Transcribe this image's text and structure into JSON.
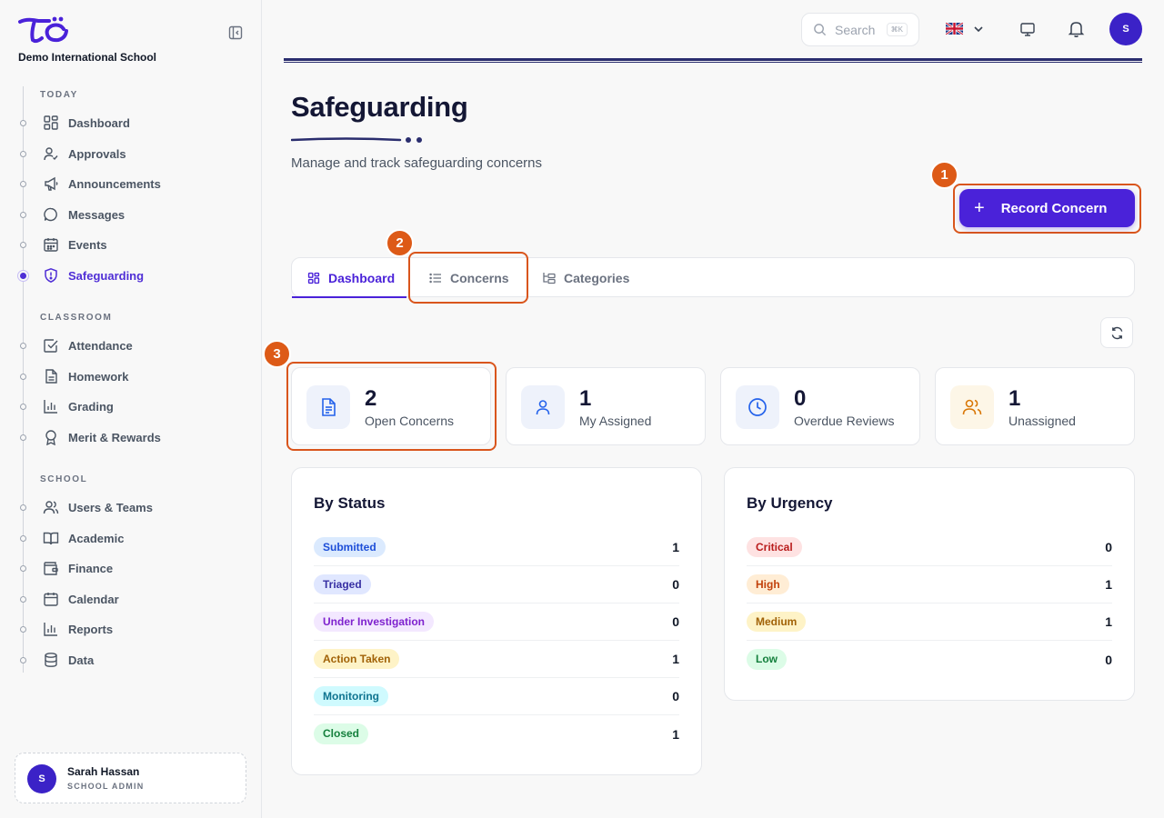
{
  "sidebar": {
    "school_name": "Demo International School",
    "sections": {
      "today": "TODAY",
      "classroom": "CLASSROOM",
      "school": "SCHOOL"
    },
    "items": {
      "dashboard": "Dashboard",
      "approvals": "Approvals",
      "announcements": "Announcements",
      "messages": "Messages",
      "events": "Events",
      "safeguarding": "Safeguarding",
      "attendance": "Attendance",
      "homework": "Homework",
      "grading": "Grading",
      "merit": "Merit & Rewards",
      "users": "Users & Teams",
      "academic": "Academic",
      "finance": "Finance",
      "calendar": "Calendar",
      "reports": "Reports",
      "data": "Data"
    },
    "active_item": "safeguarding",
    "user": {
      "initial": "S",
      "name": "Sarah Hassan",
      "role": "SCHOOL ADMIN"
    }
  },
  "topbar": {
    "search_placeholder": "Search",
    "search_shortcut": "⌘K",
    "language_icon": "uk-flag-icon",
    "avatar_initial": "S"
  },
  "page": {
    "title": "Safeguarding",
    "subtitle": "Manage and track safeguarding concerns",
    "record_button": "Record Concern"
  },
  "annotations": [
    "1",
    "2",
    "3"
  ],
  "tabs": {
    "dashboard": "Dashboard",
    "concerns": "Concerns",
    "categories": "Categories"
  },
  "stats": [
    {
      "value": "2",
      "label": "Open Concerns",
      "icon": "document-icon",
      "color": "#2563eb",
      "bg": "#eef2fb"
    },
    {
      "value": "1",
      "label": "My Assigned",
      "icon": "user-icon",
      "color": "#2563eb",
      "bg": "#eef2fb"
    },
    {
      "value": "0",
      "label": "Overdue Reviews",
      "icon": "clock-icon",
      "color": "#2563eb",
      "bg": "#eef2fb"
    },
    {
      "value": "1",
      "label": "Unassigned",
      "icon": "users-icon",
      "color": "#d97706",
      "bg": "#fdf6e7"
    }
  ],
  "by_status": {
    "title": "By Status",
    "rows": [
      {
        "label": "Submitted",
        "value": "1",
        "fg": "#1d4ed8",
        "bg": "#dbeafe"
      },
      {
        "label": "Triaged",
        "value": "0",
        "fg": "#3730a3",
        "bg": "#e0e7ff"
      },
      {
        "label": "Under Investigation",
        "value": "0",
        "fg": "#7e22ce",
        "bg": "#f3e8ff"
      },
      {
        "label": "Action Taken",
        "value": "1",
        "fg": "#a16207",
        "bg": "#fef3c7"
      },
      {
        "label": "Monitoring",
        "value": "0",
        "fg": "#0e7490",
        "bg": "#cffafe"
      },
      {
        "label": "Closed",
        "value": "1",
        "fg": "#15803d",
        "bg": "#dcfce7"
      }
    ]
  },
  "by_urgency": {
    "title": "By Urgency",
    "rows": [
      {
        "label": "Critical",
        "value": "0",
        "fg": "#b91c1c",
        "bg": "#fee2e2"
      },
      {
        "label": "High",
        "value": "1",
        "fg": "#c2410c",
        "bg": "#ffedd5"
      },
      {
        "label": "Medium",
        "value": "1",
        "fg": "#a16207",
        "bg": "#fef3c7"
      },
      {
        "label": "Low",
        "value": "0",
        "fg": "#15803d",
        "bg": "#dcfce7"
      }
    ]
  }
}
